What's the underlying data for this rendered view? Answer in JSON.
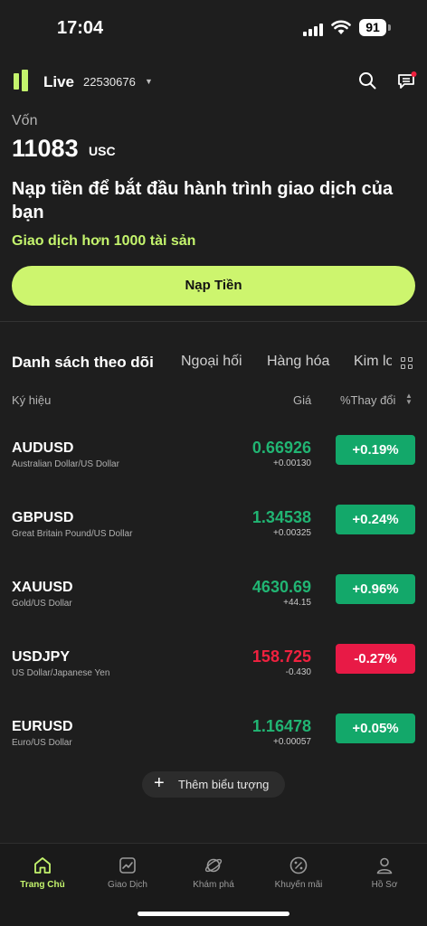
{
  "status": {
    "time": "17:04",
    "battery": "91"
  },
  "header": {
    "mode": "Live",
    "account_id": "22530676"
  },
  "balance": {
    "label": "Vốn",
    "amount": "11083",
    "currency": "USC"
  },
  "promo": {
    "headline": "Nạp tiền để bắt đầu hành trình giao dịch của bạn",
    "subline": "Giao dịch hơn 1000 tài sản",
    "deposit_button": "Nạp Tiền"
  },
  "tabs": [
    "Danh sách theo dõi",
    "Ngoại hối",
    "Hàng hóa",
    "Kim loại"
  ],
  "table": {
    "col_symbol": "Ký hiệu",
    "col_price": "Giá",
    "col_change": "%Thay đổi",
    "rows": [
      {
        "symbol": "AUDUSD",
        "desc": "Australian Dollar/US Dollar",
        "price": "0.66926",
        "delta": "+0.00130",
        "change": "+0.19%",
        "dir": "up"
      },
      {
        "symbol": "GBPUSD",
        "desc": "Great Britain Pound/US Dollar",
        "price": "1.34538",
        "delta": "+0.00325",
        "change": "+0.24%",
        "dir": "up"
      },
      {
        "symbol": "XAUUSD",
        "desc": "Gold/US Dollar",
        "price": "4630.69",
        "delta": "+44.15",
        "change": "+0.96%",
        "dir": "up"
      },
      {
        "symbol": "USDJPY",
        "desc": "US Dollar/Japanese Yen",
        "price": "158.725",
        "delta": "-0.430",
        "change": "-0.27%",
        "dir": "down"
      },
      {
        "symbol": "EURUSD",
        "desc": "Euro/US Dollar",
        "price": "1.16478",
        "delta": "+0.00057",
        "change": "+0.05%",
        "dir": "up"
      }
    ]
  },
  "add_symbol": "Thêm biểu tượng",
  "nav": [
    {
      "label": "Trang Chủ",
      "icon": "home-icon",
      "active": true
    },
    {
      "label": "Giao Dịch",
      "icon": "chart-icon",
      "active": false
    },
    {
      "label": "Khám phá",
      "icon": "planet-icon",
      "active": false
    },
    {
      "label": "Khuyến mãi",
      "icon": "percent-icon",
      "active": false
    },
    {
      "label": "Hồ Sơ",
      "icon": "profile-icon",
      "active": false
    }
  ],
  "colors": {
    "accent": "#c4f46d",
    "up": "#13a86a",
    "down": "#e81a46",
    "background": "#1e1e1e"
  }
}
